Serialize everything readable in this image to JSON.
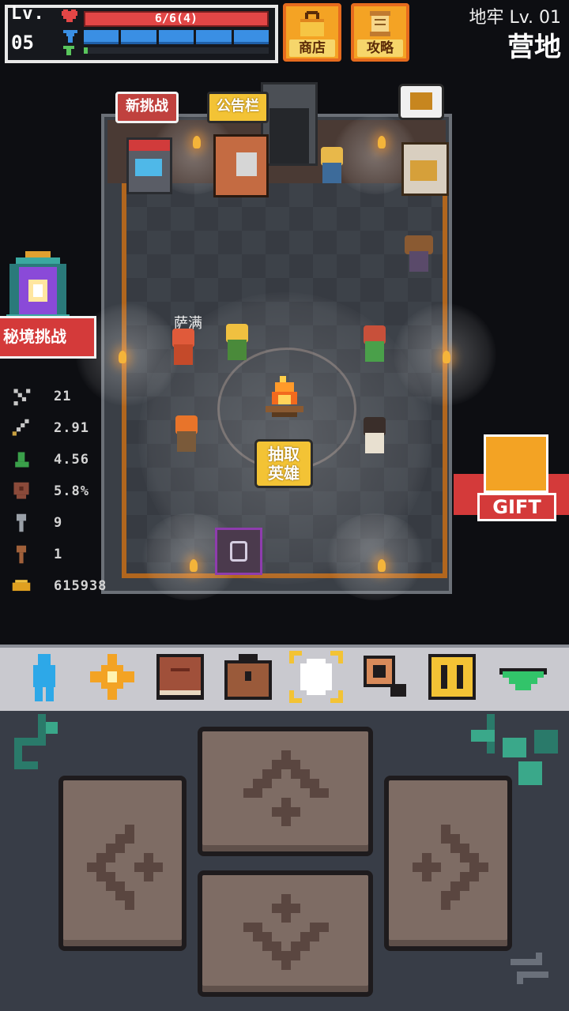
{
  "hud": {
    "level_label": "Lv.",
    "level_value": "05",
    "hp_text": "6/6(4)",
    "mp_segments": 5,
    "xp_fraction": 0.02
  },
  "top_buttons": {
    "shop_label": "商店",
    "guide_label": "攻略"
  },
  "location": {
    "dungeon_level": "地牢 Lv. 01",
    "area_name": "营地"
  },
  "room": {
    "new_challenge_label": "新挑战",
    "bulletin_label": "公告栏",
    "hero_name": "萨满",
    "gacha_label_line1": "抽取",
    "gacha_label_line2": "英雄"
  },
  "side": {
    "secret_challenge_label": "秘境挑战"
  },
  "stats": [
    {
      "icon": "crossed-swords-icon",
      "value": "21"
    },
    {
      "icon": "sword-icon",
      "value": "2.91"
    },
    {
      "icon": "boot-icon",
      "value": "4.56"
    },
    {
      "icon": "shield-icon",
      "value": "5.8%"
    },
    {
      "icon": "silver-key-icon",
      "value": "9"
    },
    {
      "icon": "bronze-key-icon",
      "value": "1"
    },
    {
      "icon": "gold-coin-icon",
      "value": "615938"
    }
  ],
  "gift_label": "GIFT",
  "toolbar": [
    {
      "name": "hero-tool",
      "icon": "person-icon"
    },
    {
      "name": "skill-tool",
      "icon": "sparkle-icon"
    },
    {
      "name": "book-tool",
      "icon": "book-icon"
    },
    {
      "name": "bag-tool",
      "icon": "backpack-icon"
    },
    {
      "name": "target-tool",
      "icon": "target-icon",
      "selected": true
    },
    {
      "name": "search-tool",
      "icon": "magnifier-icon"
    },
    {
      "name": "pause-tool",
      "icon": "pause-icon"
    },
    {
      "name": "collapse-tool",
      "icon": "triangle-down-icon"
    }
  ],
  "colors": {
    "hp": "#e24646",
    "mp": "#3a8fe4",
    "xp": "#59c65c",
    "gold_button": "#f3c335",
    "red_button": "#d43a3a"
  }
}
